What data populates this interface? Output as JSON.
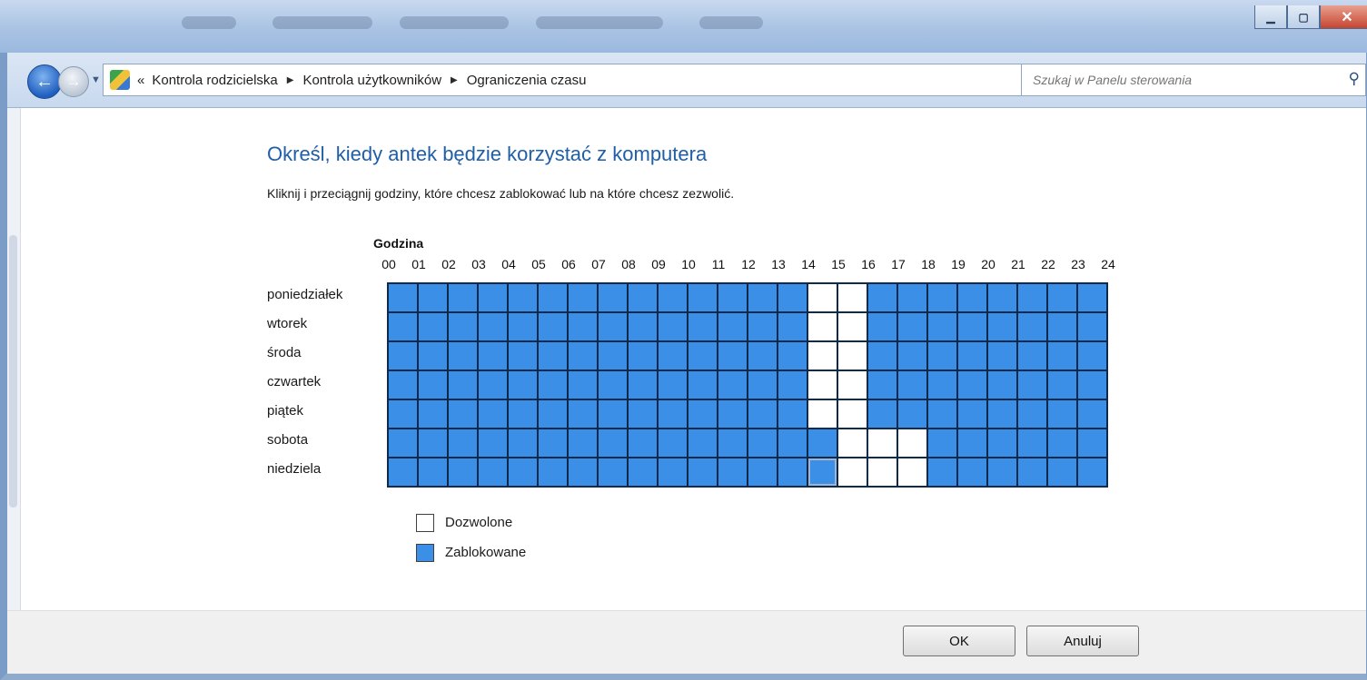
{
  "window": {
    "caption_buttons": {
      "minimize_icon": "minimize-icon",
      "maximize_icon": "maximize-icon",
      "close_icon": "close-icon"
    }
  },
  "nav": {
    "breadcrumbs": [
      "Kontrola rodzicielska",
      "Kontrola użytkowników",
      "Ograniczenia czasu"
    ],
    "overflow_glyph": "«",
    "search_placeholder": "Szukaj w Panelu sterowania"
  },
  "page": {
    "title": "Określ, kiedy antek będzie korzystać z komputera",
    "instructions": "Kliknij i przeciągnij godziny, które chcesz zablokować lub na które chcesz zezwolić.",
    "hour_title": "Godzina",
    "hours": [
      "00",
      "01",
      "02",
      "03",
      "04",
      "05",
      "06",
      "07",
      "08",
      "09",
      "10",
      "11",
      "12",
      "13",
      "14",
      "15",
      "16",
      "17",
      "18",
      "19",
      "20",
      "21",
      "22",
      "23",
      "24"
    ],
    "days": [
      "poniedziałek",
      "wtorek",
      "środa",
      "czwartek",
      "piątek",
      "sobota",
      "niedziela"
    ],
    "allowed_hours": [
      [
        14,
        15
      ],
      [
        14,
        15
      ],
      [
        14,
        15
      ],
      [
        14,
        15
      ],
      [
        14,
        15
      ],
      [
        15,
        16,
        17
      ],
      [
        15,
        16,
        17
      ]
    ],
    "legend": {
      "allowed": "Dozwolone",
      "blocked": "Zablokowane"
    },
    "colors": {
      "blocked": "#3b8fe6",
      "allowed": "#ffffff",
      "title": "#1f5ea8"
    }
  },
  "footer": {
    "ok": "OK",
    "cancel": "Anuluj"
  }
}
